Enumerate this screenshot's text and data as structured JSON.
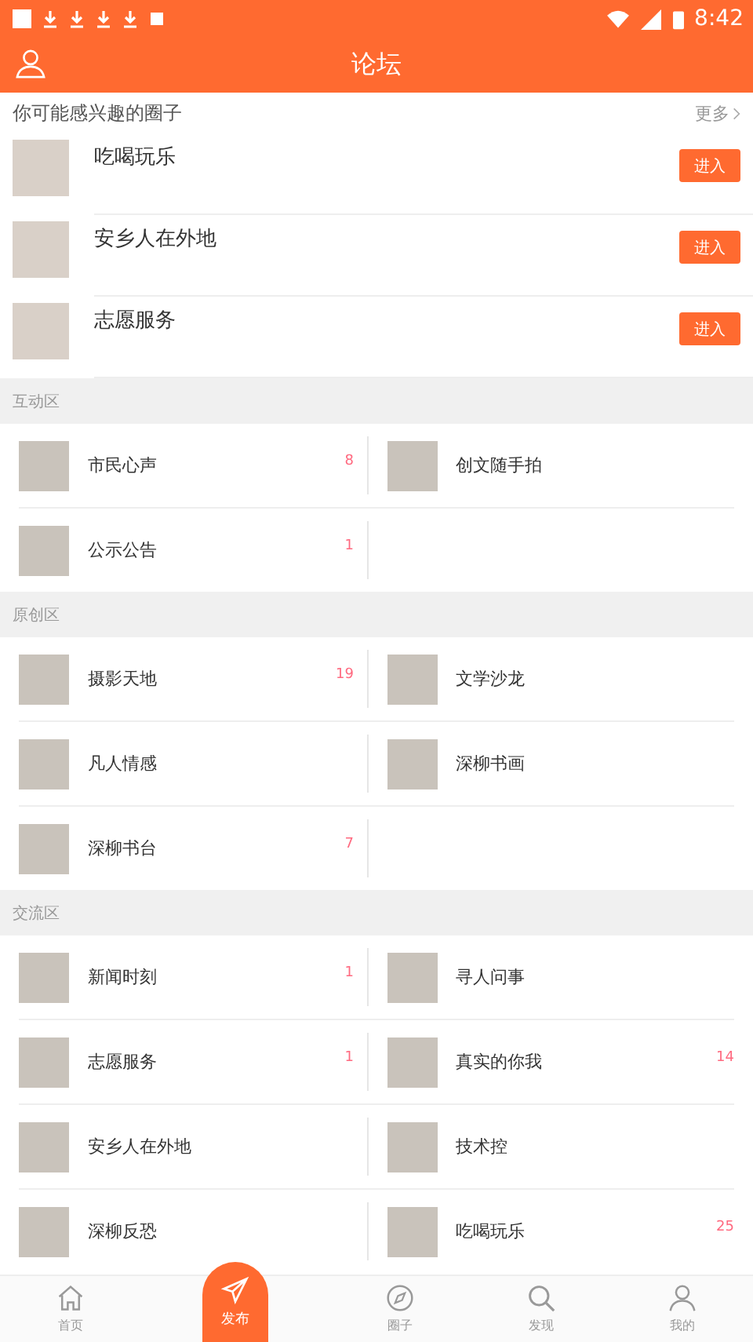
{
  "status_bar": {
    "time": "8:42"
  },
  "header": {
    "title": "论坛"
  },
  "recommended": {
    "title": "你可能感兴趣的圈子",
    "more": "更多",
    "items": [
      {
        "name": "吃喝玩乐",
        "button": "进入"
      },
      {
        "name": "安乡人在外地",
        "button": "进入"
      },
      {
        "name": "志愿服务",
        "button": "进入"
      }
    ]
  },
  "sections": [
    {
      "title": "互动区",
      "items": [
        {
          "name": "市民心声",
          "count": "8"
        },
        {
          "name": "创文随手拍"
        },
        {
          "name": "公示公告",
          "count": "1"
        }
      ]
    },
    {
      "title": "原创区",
      "items": [
        {
          "name": "摄影天地",
          "count": "19"
        },
        {
          "name": "文学沙龙"
        },
        {
          "name": "凡人情感"
        },
        {
          "name": "深柳书画"
        },
        {
          "name": "深柳书台",
          "count": "7"
        }
      ]
    },
    {
      "title": "交流区",
      "items": [
        {
          "name": "新闻时刻",
          "count": "1"
        },
        {
          "name": "寻人问事"
        },
        {
          "name": "志愿服务",
          "count": "1"
        },
        {
          "name": "真实的你我",
          "count": "14"
        },
        {
          "name": "安乡人在外地"
        },
        {
          "name": "技术控"
        },
        {
          "name": "深柳反恐"
        },
        {
          "name": "吃喝玩乐",
          "count": "25"
        }
      ]
    }
  ],
  "bottom_nav": [
    {
      "kind": "home",
      "label": "首页",
      "selected": false
    },
    {
      "kind": "publish",
      "label": "发布"
    },
    {
      "kind": "compass",
      "label": "圈子",
      "selected": false
    },
    {
      "kind": "search",
      "label": "发现",
      "selected": false
    },
    {
      "kind": "person",
      "label": "我的",
      "selected": false
    }
  ]
}
